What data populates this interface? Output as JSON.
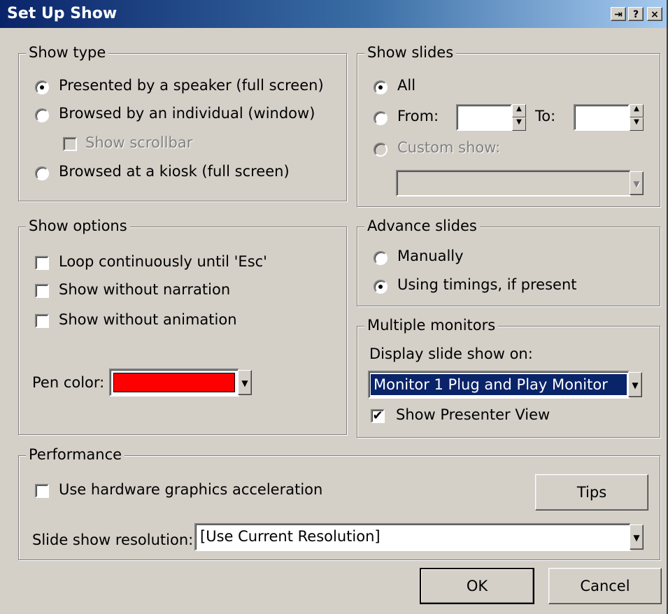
{
  "window": {
    "title": "Set Up Show",
    "controls": {
      "pin": "⇥",
      "help": "?",
      "close": "×"
    }
  },
  "show_type": {
    "label": "Show type",
    "options": [
      {
        "label": "Presented by a speaker (full screen)",
        "checked": true
      },
      {
        "label": "Browsed by an individual (window)",
        "checked": false
      },
      {
        "label": "Browsed at a kiosk (full screen)",
        "checked": false
      }
    ],
    "show_scrollbar_label": "Show scrollbar"
  },
  "show_slides": {
    "label": "Show slides",
    "all_label": "All",
    "from_label": "From:",
    "to_label": "To:",
    "from_value": "",
    "to_value": "",
    "custom_show_label": "Custom show:",
    "custom_show_value": ""
  },
  "show_options": {
    "label": "Show options",
    "loop_label": "Loop continuously until 'Esc'",
    "no_narration_label": "Show without narration",
    "no_animation_label": "Show without animation",
    "pen_color_label": "Pen color:",
    "pen_color": "#ff0000"
  },
  "advance_slides": {
    "label": "Advance slides",
    "manually_label": "Manually",
    "timings_label": "Using timings, if present"
  },
  "multiple_monitors": {
    "label": "Multiple monitors",
    "display_on_label": "Display slide show on:",
    "monitor_value": "Monitor 1 Plug and Play Monitor",
    "presenter_view_label": "Show Presenter View",
    "presenter_view_checked": true
  },
  "performance": {
    "label": "Performance",
    "hw_accel_label": "Use hardware graphics acceleration",
    "tips_label": "Tips",
    "resolution_label": "Slide show resolution:",
    "resolution_value": "[Use Current Resolution]"
  },
  "buttons": {
    "ok": "OK",
    "cancel": "Cancel"
  }
}
